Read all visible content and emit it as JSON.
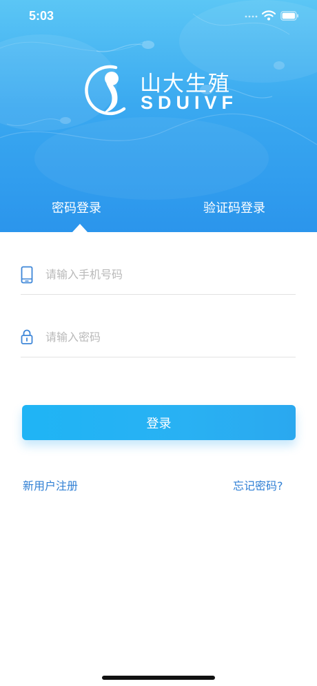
{
  "status_bar": {
    "time": "5:03",
    "icons": [
      "signal-icon",
      "wifi-icon",
      "battery-icon"
    ]
  },
  "brand": {
    "name_cn": "山大生殖",
    "name_en": "SDUIVF",
    "icon": "logo-mark-icon"
  },
  "tabs": [
    {
      "label": "密码登录",
      "active": true
    },
    {
      "label": "验证码登录",
      "active": false
    }
  ],
  "form": {
    "phone": {
      "placeholder": "请输入手机号码",
      "value": "",
      "icon": "phone-icon"
    },
    "password": {
      "placeholder": "请输入密码",
      "value": "",
      "icon": "lock-icon"
    },
    "submit_label": "登录"
  },
  "links": {
    "register": "新用户注册",
    "forgot": "忘记密码?"
  },
  "colors": {
    "header_gradient_top": "#5bc6f5",
    "header_gradient_bottom": "#2b95ec",
    "button": "#29b1f3",
    "link": "#2f7fd4",
    "icon": "#3d86d8"
  }
}
